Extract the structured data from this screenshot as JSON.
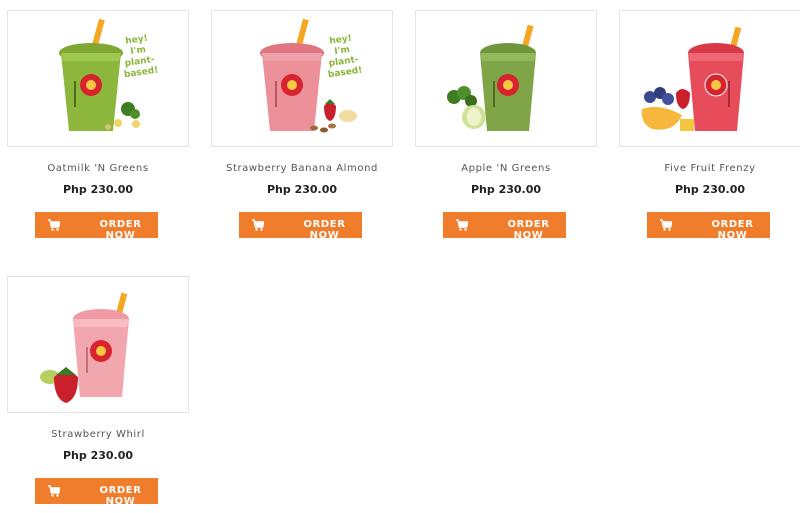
{
  "products": [
    {
      "name": "Oatmilk 'N Greens",
      "price": "Php 230.00",
      "order_label": "ORDER NOW",
      "badge": "hey! I'm plant-based!",
      "drink_color": "#8cb63c",
      "image": "smoothie-green-plant-based"
    },
    {
      "name": "Strawberry Banana Almond",
      "price": "Php 230.00",
      "order_label": "ORDER NOW",
      "badge": "hey! I'm plant-based!",
      "drink_color": "#e9848f",
      "image": "smoothie-pink-plant-based"
    },
    {
      "name": "Apple 'N Greens",
      "price": "Php 230.00",
      "order_label": "ORDER NOW",
      "drink_color": "#7fa548",
      "image": "smoothie-green-apple"
    },
    {
      "name": "Five Fruit Frenzy",
      "price": "Php 230.00",
      "order_label": "ORDER NOW",
      "drink_color": "#e64c5a",
      "image": "smoothie-red-berries"
    },
    {
      "name": "Strawberry Whirl",
      "price": "Php 230.00",
      "order_label": "ORDER NOW",
      "drink_color": "#f2a6ae",
      "image": "smoothie-pink-strawberry"
    }
  ],
  "colors": {
    "button": "#f07d2b",
    "card_border": "#e4e4e4",
    "badge_text": "#8bb53a"
  },
  "icons": {
    "order": "shopping-cart-icon"
  }
}
